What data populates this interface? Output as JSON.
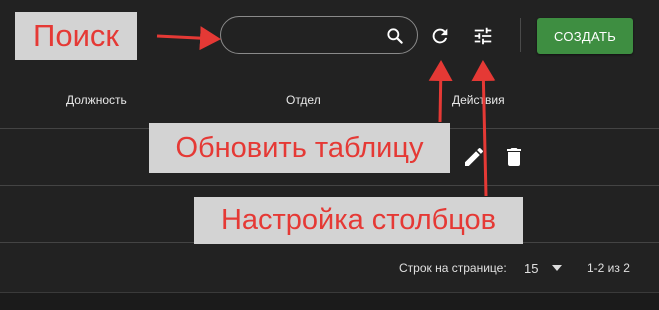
{
  "toolbar": {
    "search": {
      "placeholder": "",
      "value": ""
    },
    "create_label": "СОЗДАТЬ"
  },
  "table": {
    "headers": [
      "Должность",
      "Отдел",
      "Действия"
    ],
    "rows": [
      {
        "title": "",
        "department": ""
      },
      {
        "title": "",
        "department": ""
      }
    ]
  },
  "pagination": {
    "rows_per_page_label": "Строк на странице:",
    "rows_per_page_value": "15",
    "range_label": "1-2 из 2"
  },
  "annotations": {
    "search": "Поиск",
    "refresh": "Обновить таблицу",
    "columns": "Настройка столбцов"
  },
  "colors": {
    "background": "#222222",
    "create_button": "#3e8e41",
    "annotation_text": "#e53935",
    "annotation_bg": "#d3d3d3"
  },
  "icons": [
    "search-icon",
    "refresh-icon",
    "column-settings-icon",
    "edit-icon",
    "delete-icon",
    "dropdown-arrow-icon"
  ]
}
